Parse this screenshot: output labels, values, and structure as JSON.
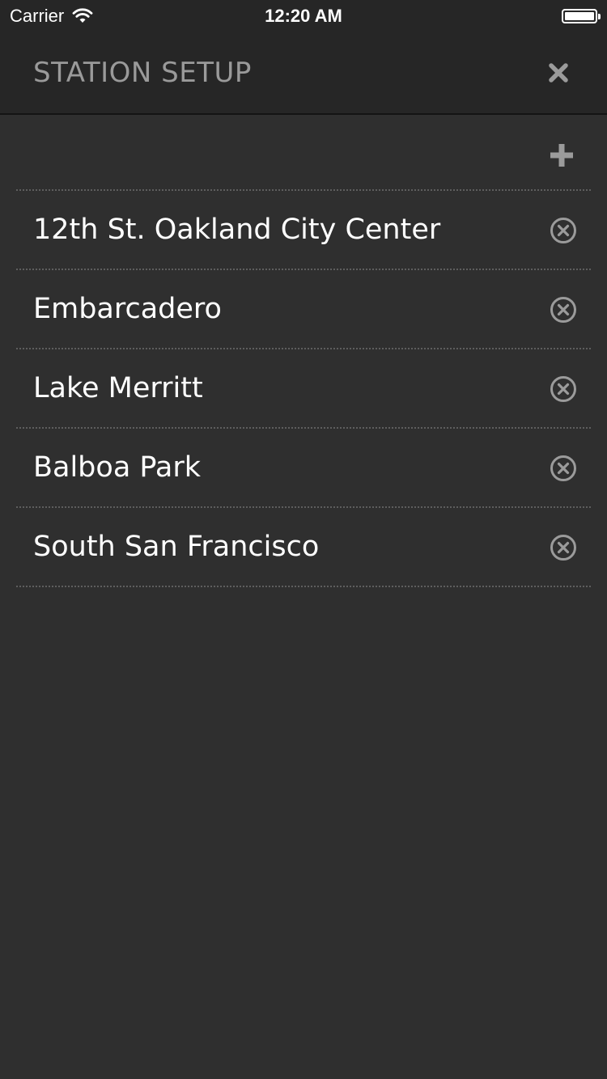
{
  "status_bar": {
    "carrier": "Carrier",
    "time": "12:20 AM",
    "wifi_icon": "wifi-icon",
    "battery_icon": "battery-icon"
  },
  "header": {
    "title": "STATION SETUP",
    "close_icon": "close-icon"
  },
  "toolbar": {
    "add_icon": "plus-icon"
  },
  "stations": [
    {
      "name": "12th St. Oakland City Center",
      "remove_icon": "remove-circle-icon"
    },
    {
      "name": "Embarcadero",
      "remove_icon": "remove-circle-icon"
    },
    {
      "name": "Lake Merritt",
      "remove_icon": "remove-circle-icon"
    },
    {
      "name": "Balboa Park",
      "remove_icon": "remove-circle-icon"
    },
    {
      "name": "South San Francisco",
      "remove_icon": "remove-circle-icon"
    }
  ],
  "colors": {
    "background": "#2f2f2f",
    "header_background": "#262626",
    "title_text": "#9a9a9a",
    "station_text": "#ffffff",
    "icon_gray": "#9b9b9b",
    "divider": "#5e5e5e"
  }
}
